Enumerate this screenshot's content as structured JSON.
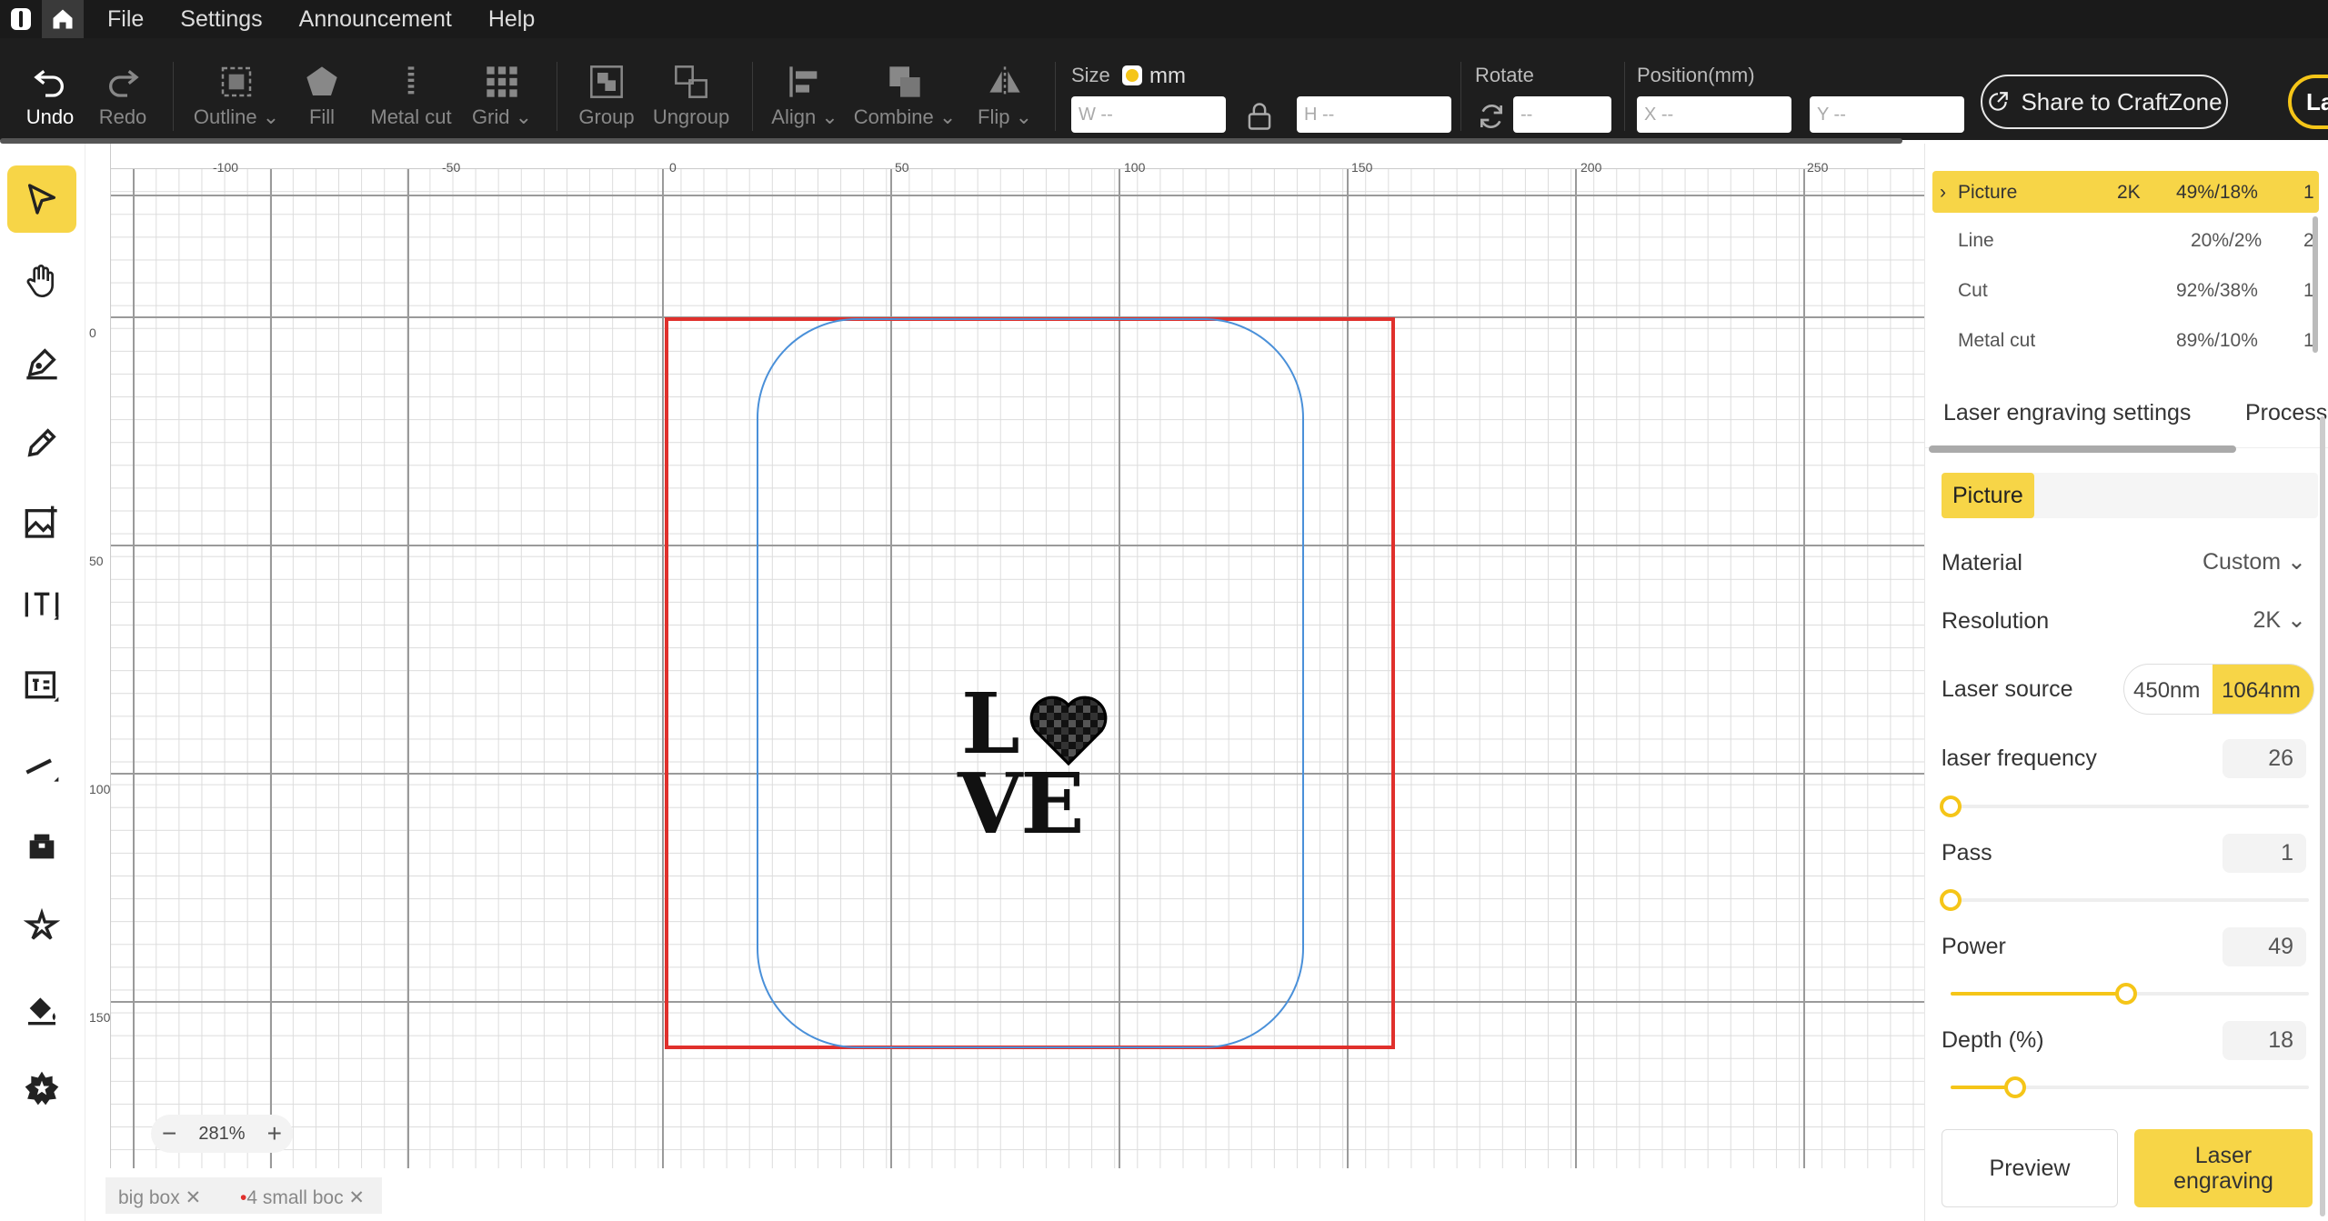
{
  "menu": [
    "File",
    "Settings",
    "Announcement",
    "Help"
  ],
  "toolbar": {
    "undo": "Undo",
    "redo": "Redo",
    "outline": "Outline",
    "fill": "Fill",
    "metalcut": "Metal cut",
    "grid": "Grid",
    "group": "Group",
    "ungroup": "Ungroup",
    "align": "Align",
    "combine": "Combine",
    "flip": "Flip",
    "size_label": "Size",
    "unit": "mm",
    "w_placeholder": "W --",
    "h_placeholder": "H --",
    "rotate_label": "Rotate",
    "rotate_placeholder": "--",
    "position_label": "Position(mm)",
    "x_placeholder": "X --",
    "y_placeholder": "Y --",
    "share": "Share to CraftZone",
    "laser_short": "La"
  },
  "ruler": {
    "h": [
      "-100",
      "-50",
      "0",
      "50",
      "100",
      "150",
      "200",
      "250"
    ],
    "v": [
      "0",
      "50",
      "100",
      "150"
    ]
  },
  "canvas": {
    "text_line1": "L",
    "text_line2": "VE",
    "zoom": "281%"
  },
  "doc_tabs": [
    "big box",
    "4 small boc"
  ],
  "layers": [
    {
      "name": "Picture",
      "res": "2K",
      "pd": "49%/18%",
      "count": "1"
    },
    {
      "name": "Line",
      "res": "",
      "pd": "20%/2%",
      "count": "2"
    },
    {
      "name": "Cut",
      "res": "",
      "pd": "92%/38%",
      "count": "1"
    },
    {
      "name": "Metal cut",
      "res": "",
      "pd": "89%/10%",
      "count": "1"
    }
  ],
  "panel": {
    "tab1": "Laser engraving settings",
    "tab2": "Process",
    "chip": "Picture",
    "material_label": "Material",
    "material_value": "Custom",
    "resolution_label": "Resolution",
    "resolution_value": "2K",
    "source_label": "Laser source",
    "source_a": "450nm",
    "source_b": "1064nm",
    "freq_label": "laser frequency",
    "freq_value": "26",
    "freq_level": 0,
    "pass_label": "Pass",
    "pass_value": "1",
    "pass_level": 0,
    "power_label": "Power",
    "power_value": "49",
    "power_level": 0.49,
    "depth_label": "Depth (%)",
    "depth_value": "18",
    "depth_level": 0.18,
    "preview": "Preview",
    "engrave1": "Laser",
    "engrave2": "engraving"
  },
  "colors": {
    "accent": "#f7d547",
    "selection": "#e0302c",
    "shape": "#4a90d9"
  }
}
